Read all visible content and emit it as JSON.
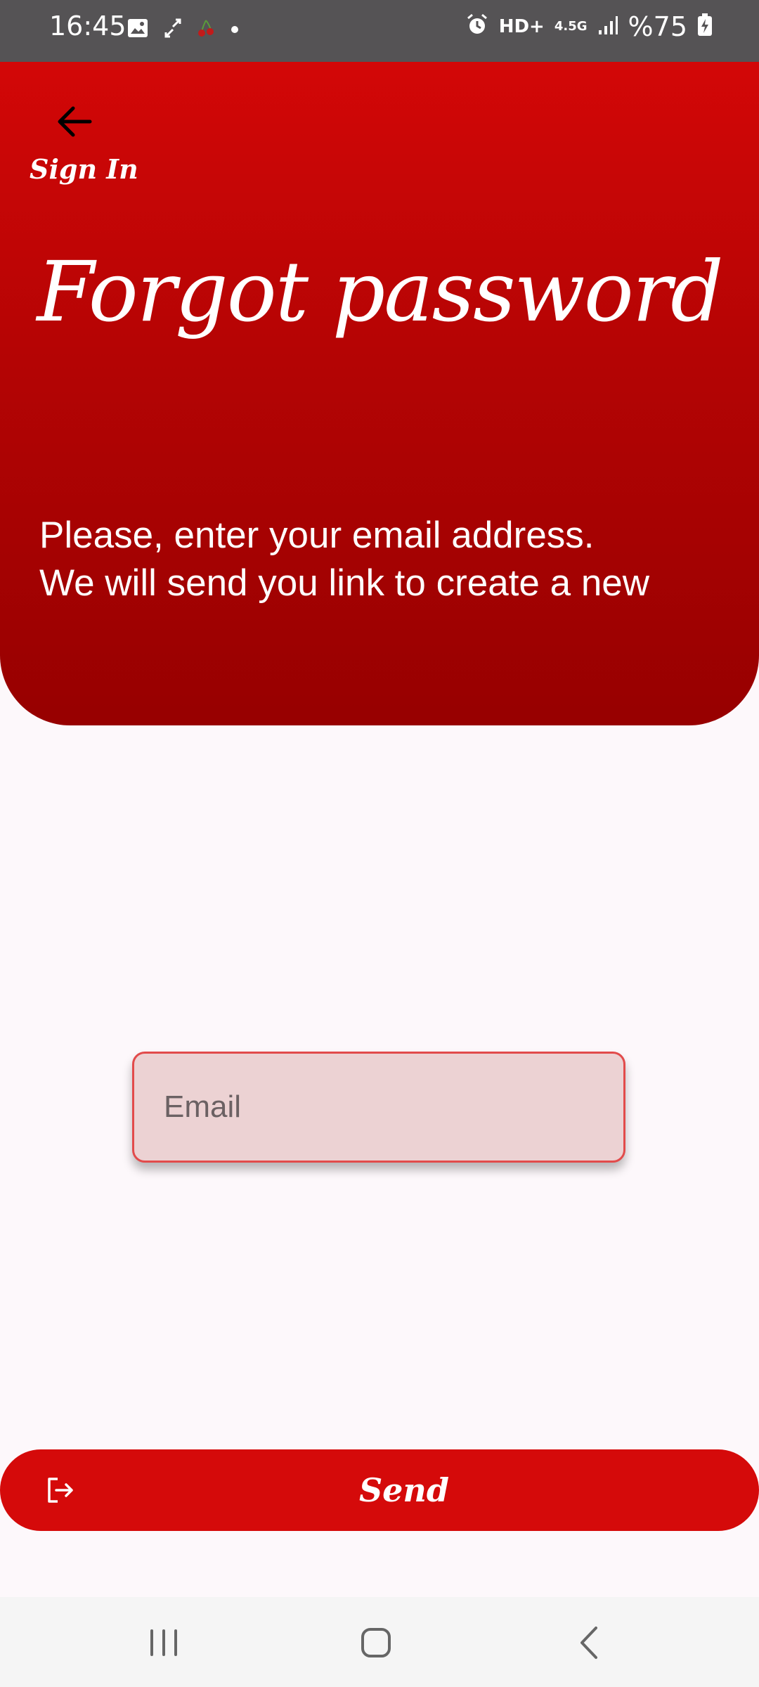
{
  "status_bar": {
    "time": "16:45",
    "left_icons": [
      "image-icon",
      "sync-icon",
      "cherry-icon",
      "dot-icon"
    ],
    "right_icons": [
      "alarm-icon",
      "hd-plus-icon",
      "network-4.5g-icon",
      "signal-icon"
    ],
    "hd_text": "HD+",
    "network_text": "4.5G",
    "battery_text": "%75"
  },
  "header": {
    "back_label": "Sign In",
    "title": "Forgot password",
    "description_line1": "Please, enter your email address.",
    "description_line2": "We will send you link to create a new",
    "colors": {
      "top": "#d30707",
      "bottom": "#970000"
    }
  },
  "form": {
    "email_placeholder": "Email",
    "email_value": ""
  },
  "send_button": {
    "label": "Send",
    "icon": "logout-arrow-icon",
    "color": "#d50a0a"
  },
  "nav_bar": {
    "items": [
      "recent-apps-icon",
      "home-icon",
      "back-nav-icon"
    ]
  }
}
